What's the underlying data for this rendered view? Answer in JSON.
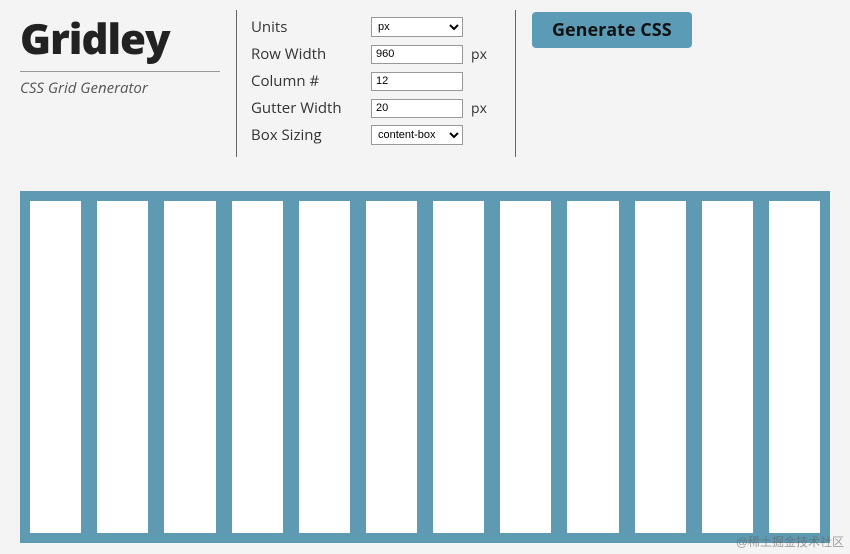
{
  "brand": {
    "title": "Gridley",
    "subtitle": "CSS Grid Generator"
  },
  "config": {
    "units_label": "Units",
    "units_value": "px",
    "row_width_label": "Row Width",
    "row_width_value": "960",
    "row_width_unit": "px",
    "column_count_label": "Column #",
    "column_count_value": "12",
    "gutter_width_label": "Gutter Width",
    "gutter_width_value": "20",
    "gutter_width_unit": "px",
    "box_sizing_label": "Box Sizing",
    "box_sizing_value": "content-box"
  },
  "action": {
    "generate_label": "Generate CSS"
  },
  "preview": {
    "column_count": 12,
    "accent_color": "#5e9ab2"
  },
  "watermark": "@稀土掘金技术社区"
}
